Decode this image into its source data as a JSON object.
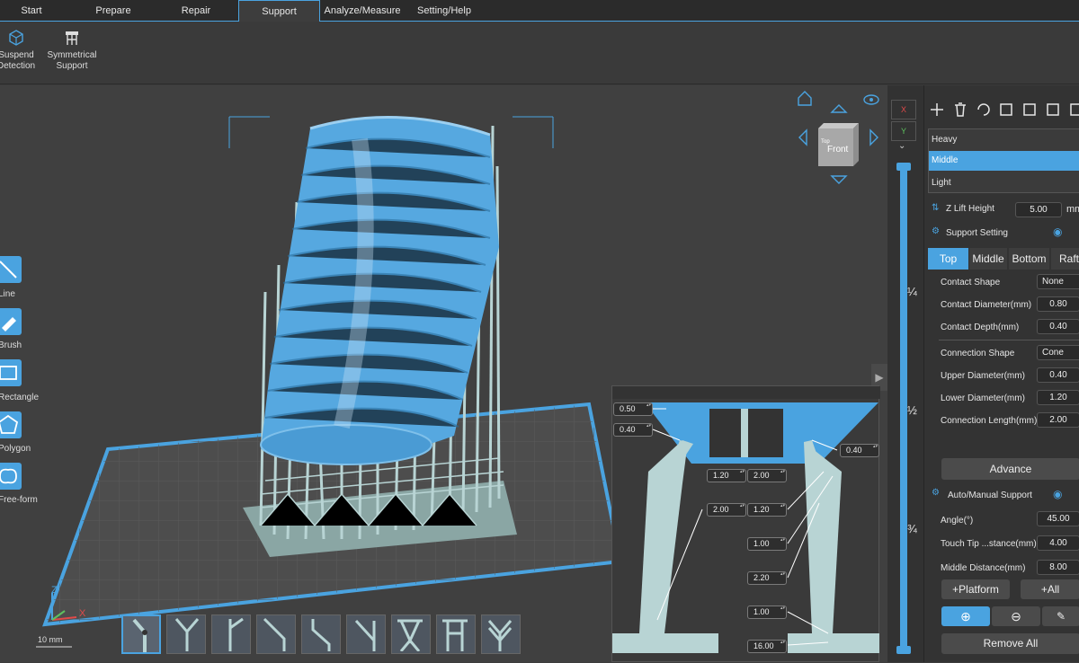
{
  "menu": {
    "tabs": [
      {
        "label": "Start"
      },
      {
        "label": "Prepare"
      },
      {
        "label": "Repair"
      },
      {
        "label": "Support"
      },
      {
        "label": "Analyze/Measure"
      },
      {
        "label": "Setting/Help"
      }
    ],
    "active": "Support"
  },
  "toolbar": {
    "suspend_label_1": "Suspend",
    "suspend_label_2": "Detection",
    "symmetrical_label_1": "Symmetrical",
    "symmetrical_label_2": "Support"
  },
  "left_tools": [
    {
      "label": "Line",
      "icon": "line-icon"
    },
    {
      "label": "Brush",
      "icon": "brush-icon"
    },
    {
      "label": "Rectangle",
      "icon": "rectangle-icon"
    },
    {
      "label": "Polygon",
      "icon": "polygon-icon"
    },
    {
      "label": "Free-form",
      "icon": "free-form-icon"
    }
  ],
  "view_cube": {
    "face": "Front",
    "top": "Top"
  },
  "axes": {
    "x": "X",
    "y": "Y",
    "z": "Z",
    "scale": "10 mm"
  },
  "strip": {
    "x_btn": "X",
    "y_btn": "Y",
    "quarter": "¼",
    "half": "½",
    "three_quarter": "¾"
  },
  "presets": {
    "items": [
      "Heavy",
      "Middle",
      "Light"
    ],
    "selected": "Middle"
  },
  "z_lift": {
    "label": "Z Lift Height",
    "value": "5.00",
    "unit": "mm"
  },
  "support_setting": {
    "title": "Support Setting",
    "tabs": [
      "Top",
      "Middle",
      "Bottom",
      "Raft"
    ],
    "active_tab": "Top",
    "contact_shape": {
      "label": "Contact Shape",
      "value": "None"
    },
    "contact_diameter": {
      "label": "Contact Diameter(mm)",
      "value": "0.80"
    },
    "contact_depth": {
      "label": "Contact Depth(mm)",
      "value": "0.40"
    },
    "connection_shape": {
      "label": "Connection Shape",
      "value": "Cone"
    },
    "upper_diameter": {
      "label": "Upper Diameter(mm)",
      "value": "0.40"
    },
    "lower_diameter": {
      "label": "Lower Diameter(mm)",
      "value": "1.20"
    },
    "connection_length": {
      "label": "Connection Length(mm)",
      "value": "2.00"
    },
    "advance": "Advance"
  },
  "auto_manual": {
    "title": "Auto/Manual Support",
    "angle": {
      "label": "Angle(°)",
      "value": "45.00"
    },
    "touch_tip": {
      "label": "Touch Tip ...stance(mm)",
      "value": "4.00"
    },
    "middle_distance": {
      "label": "Middle Distance(mm)",
      "value": "8.00"
    },
    "platform_btn": "+Platform",
    "all_btn": "+All",
    "remove_all": "Remove All"
  },
  "diagram": {
    "v1": "0.50",
    "v2": "0.40",
    "v3": "0.40",
    "v4": "1.20",
    "v5": "2.00",
    "v6": "2.00",
    "v7": "1.20",
    "v8": "1.00",
    "v9": "2.20",
    "v10": "1.00",
    "v11": "16.00"
  },
  "colors": {
    "accent": "#4aa3e0",
    "support": "#b8d4d4",
    "model": "#56a8e0"
  }
}
